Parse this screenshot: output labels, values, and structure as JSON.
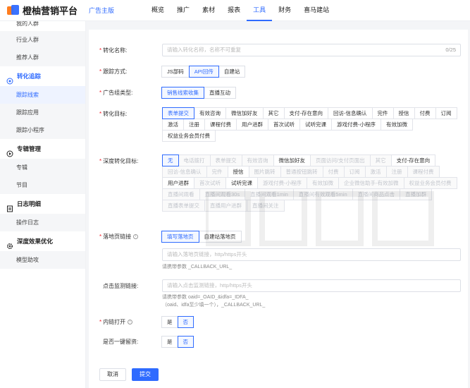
{
  "header": {
    "brand": "橙柚营销平台",
    "sub_brand": "广告主版",
    "nav": [
      "概览",
      "推广",
      "素材",
      "报表",
      "工具",
      "财务",
      "喜马建站"
    ],
    "active_nav": "工具"
  },
  "sidebar": {
    "top_partial": "我的人群",
    "items_top": [
      "行业人群",
      "推荐人群"
    ],
    "groups": [
      {
        "label": "转化追踪",
        "icon": "target-icon",
        "items": [
          "跟踪线索",
          "跟踪应用",
          "跟踪小程序"
        ],
        "active": "跟踪线索"
      },
      {
        "label": "专辑管理",
        "icon": "album-icon",
        "items": [
          "专辑",
          "节目"
        ]
      },
      {
        "label": "日志明细",
        "icon": "log-icon",
        "items": [
          "操作日志"
        ]
      },
      {
        "label": "深度效果优化",
        "icon": "gear-icon",
        "items": [
          "模型助攻"
        ]
      }
    ]
  },
  "form": {
    "name": {
      "label": "转化名称:",
      "placeholder": "请输入转化名称，名称不可重复",
      "counter": "0/25"
    },
    "track": {
      "label": "跟踪方式:",
      "options": [
        "JS部码",
        "API回传",
        "自建站"
      ],
      "selected": "API回传"
    },
    "ad_type": {
      "label": "广告组类型:",
      "options": [
        "销售线索收集",
        "直播互动"
      ],
      "selected": "销售线索收集"
    },
    "target": {
      "label": "转化目标:",
      "options": [
        "表单提交",
        "有效咨询",
        "微信加好友",
        "其它",
        "支付-存在意向",
        "回访-信息确认",
        "完件",
        "授信",
        "付费",
        "订阅",
        "激活",
        "注册",
        "课程付费",
        "用户进群",
        "首次试听",
        "试听完课",
        "游戏付费-小程序",
        "有效加微",
        "权益业务会员付费"
      ],
      "selected": "表单提交"
    },
    "deep": {
      "label": "深度转化目标:",
      "options": [
        "无",
        "电话拨打",
        "表单提交",
        "有效咨询",
        "微信加好友",
        "页面访问/支付页面出",
        "其它",
        "支付-存在意向",
        "回访-信息确认",
        "完件",
        "授信",
        "图片跳转",
        "普通按钮跳转",
        "付费",
        "订阅",
        "激活",
        "注册",
        "课程付费",
        "用户进群",
        "首次试听",
        "试听完课",
        "游戏付费-小程序",
        "有效加微",
        "企业微信助手-有效加微",
        "权益业务会员付费",
        "直播间观看",
        "直播间观看30s",
        "直播间观看1min",
        "直播间有效观看5min",
        "直播间商品点击",
        "直播加群",
        "直播表单提交",
        "直播用户进群",
        "直播间关注"
      ],
      "selected": "无",
      "enabled": [
        "无",
        "微信加好友",
        "支付-存在意向",
        "授信",
        "用户进群",
        "试听完课"
      ]
    },
    "landing": {
      "label": "落地页链接",
      "options": [
        "填写落地页",
        "自建站落地页"
      ],
      "selected": "填写落地页",
      "placeholder": "请输入落地页链接，http/https开头",
      "hint": "请携带参数 _CALLBACK_URL_"
    },
    "monitor": {
      "label": "点击监测链接:",
      "placeholder": "请输入点击监测链接，http/https开头",
      "hint1": "请携带参数 oaid=_OAID_&idfa=_IDFA_",
      "hint2": "（oaid、idfa至少填一个），_CALLBACK_URL_"
    },
    "inner": {
      "label": "内链打开",
      "options": [
        "是",
        "否"
      ],
      "selected": "否"
    },
    "leave": {
      "label": "是否一键留资:",
      "options": [
        "是",
        "否"
      ],
      "selected": "否"
    },
    "cancel": "取消",
    "submit": "提交",
    "accent": "#2f6bff"
  }
}
